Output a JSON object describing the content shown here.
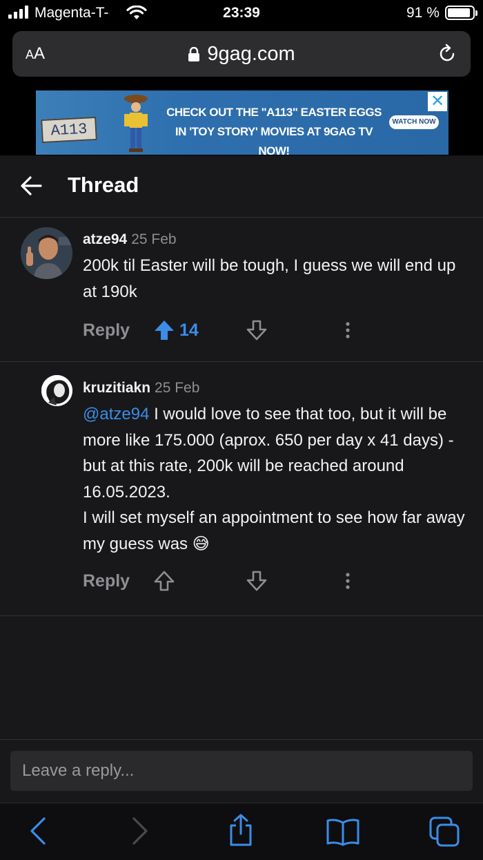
{
  "status_bar": {
    "carrier": "Magenta-T-",
    "time": "23:39",
    "battery_percent": "91 %",
    "battery_level": 0.91
  },
  "browser": {
    "text_size_label_small": "A",
    "text_size_label_large": "A",
    "url": "9gag.com"
  },
  "ad": {
    "plate_text": "A113",
    "headline_line1": "CHECK OUT THE \"A113\" EASTER EGGS",
    "headline_line2": "IN 'TOY STORY' MOVIES AT 9GAG TV NOW!",
    "button_label": "WATCH NOW",
    "close_label": "✕",
    "colors": {
      "background": "#2e6fae",
      "close": "#2aa0e0"
    }
  },
  "header": {
    "title": "Thread"
  },
  "comments": [
    {
      "username": "atze94",
      "date": "25 Feb",
      "text": "200k til Easter will be tough, I guess we will end up at 190k",
      "reply_label": "Reply",
      "upvotes": "14",
      "upvoted": true
    },
    {
      "username": "kruzitiakn",
      "date": "25 Feb",
      "mention": "@atze94",
      "text_line1": " I would love to see that too, but it will be more like 175.000 (aprox. 650 per day x 41 days) - but at this rate, 200k will be reached around 16.05.2023.",
      "text_line2": "I will set myself an appointment to see how far away my guess was 😅",
      "reply_label": "Reply",
      "upvoted": false
    }
  ],
  "reply_box": {
    "placeholder": "Leave a reply..."
  },
  "colors": {
    "accent": "#3b8de8",
    "background": "#18181a",
    "muted": "#8e8e93",
    "toolbar_icon": "#3b8de8"
  }
}
